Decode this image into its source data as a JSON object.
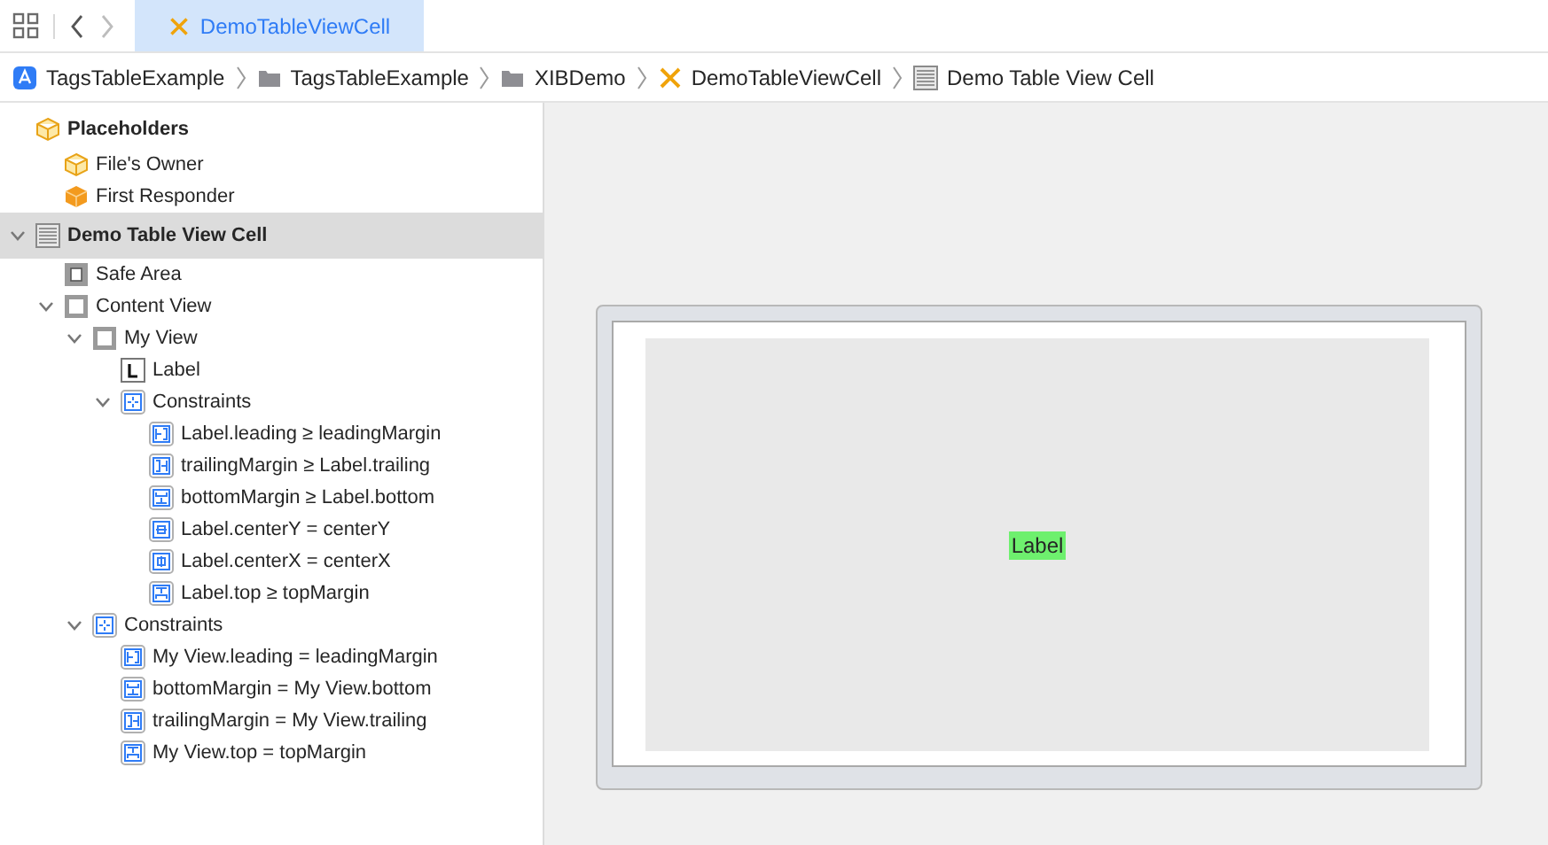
{
  "toolbar": {
    "back": {
      "disabled": false
    },
    "forward": {
      "disabled": true
    }
  },
  "tabs": [
    {
      "label": "DemoTableViewCell",
      "kind": "xib",
      "selected": true
    }
  ],
  "breadcrumb": [
    {
      "label": "TagsTableExample",
      "kind": "app"
    },
    {
      "label": "TagsTableExample",
      "kind": "folder"
    },
    {
      "label": "XIBDemo",
      "kind": "folder"
    },
    {
      "label": "DemoTableViewCell",
      "kind": "xib"
    },
    {
      "label": "Demo Table View Cell",
      "kind": "table"
    }
  ],
  "outline": [
    {
      "label": "Placeholders",
      "kind": "cube",
      "bold": true,
      "selected": false,
      "children": [
        {
          "label": "File's Owner",
          "kind": "cube",
          "selected": false
        },
        {
          "label": "First Responder",
          "kind": "responder",
          "selected": false
        }
      ]
    },
    {
      "label": "Demo Table View Cell",
      "kind": "table",
      "bold": true,
      "expanded": true,
      "selected": true,
      "children": [
        {
          "label": "Safe Area",
          "kind": "safe",
          "selected": false
        },
        {
          "label": "Content View",
          "kind": "view",
          "expanded": true,
          "selected": false,
          "children": [
            {
              "label": "My View",
              "kind": "view",
              "expanded": true,
              "selected": false,
              "children": [
                {
                  "label": "Label",
                  "kind": "label",
                  "selected": false
                },
                {
                  "label": "Constraints",
                  "kind": "constraints",
                  "expanded": true,
                  "selected": false,
                  "children": [
                    {
                      "label": "Label.leading ≥ leadingMargin",
                      "kind": "leading",
                      "selected": false
                    },
                    {
                      "label": "trailingMargin ≥ Label.trailing",
                      "kind": "trailing",
                      "selected": false
                    },
                    {
                      "label": "bottomMargin ≥ Label.bottom",
                      "kind": "bottom",
                      "selected": false
                    },
                    {
                      "label": "Label.centerY = centerY",
                      "kind": "centery",
                      "selected": false
                    },
                    {
                      "label": "Label.centerX = centerX",
                      "kind": "centerx",
                      "selected": false
                    },
                    {
                      "label": "Label.top ≥ topMargin",
                      "kind": "top",
                      "selected": false
                    }
                  ]
                }
              ]
            },
            {
              "label": "Constraints",
              "kind": "constraints",
              "expanded": true,
              "selected": false,
              "children": [
                {
                  "label": "My View.leading = leadingMargin",
                  "kind": "leading",
                  "selected": false
                },
                {
                  "label": "bottomMargin = My View.bottom",
                  "kind": "bottom",
                  "selected": false
                },
                {
                  "label": "trailingMargin = My View.trailing",
                  "kind": "trailing",
                  "selected": false
                },
                {
                  "label": "My View.top = topMargin",
                  "kind": "top",
                  "selected": false
                }
              ]
            }
          ]
        }
      ]
    }
  ],
  "canvas": {
    "label": "Label"
  }
}
